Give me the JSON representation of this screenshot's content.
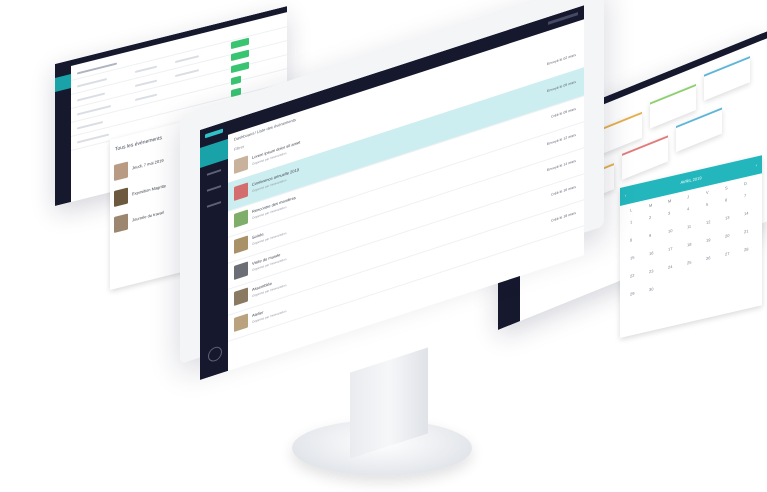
{
  "panels": {
    "list": {
      "section_title": "Tous les évènements",
      "items": [
        {
          "label": "Jeudi, 7 mai 2019"
        },
        {
          "label": "Exposition Magritte"
        },
        {
          "label": "Journée du travail"
        }
      ]
    },
    "monitor": {
      "breadcrumb": "Dashboard / Liste des évènements",
      "filter_label": "Filtrer",
      "rows": [
        {
          "title": "Lorem ipsum dolor sit amet",
          "meta": "Organisé par l'association",
          "status": "Envoyé le 02 mars"
        },
        {
          "title": "Conference annuelle 2019",
          "meta": "Organisé par l'association",
          "status": "Envoyé le 09 mars"
        },
        {
          "title": "Rencontre des membres",
          "meta": "Organisé par l'association",
          "status": "Créé le 09 mars"
        },
        {
          "title": "Soirée",
          "meta": "Organisé par l'association",
          "status": "Envoyé le 12 mars"
        },
        {
          "title": "Visite du musée",
          "meta": "Organisé par l'association",
          "status": "Envoyé le 14 mars"
        },
        {
          "title": "Assemblée",
          "meta": "Organisé par l'association",
          "status": "Créé le 16 mars"
        },
        {
          "title": "Atelier",
          "meta": "Organisé par l'association",
          "status": "Créé le 18 mars"
        }
      ]
    },
    "calendar": {
      "month": "AVRIL 2019",
      "weekdays": [
        "L",
        "M",
        "M",
        "J",
        "V",
        "S",
        "D"
      ],
      "days": [
        "1",
        "2",
        "3",
        "4",
        "5",
        "6",
        "7",
        "8",
        "9",
        "10",
        "11",
        "12",
        "13",
        "14",
        "15",
        "16",
        "17",
        "18",
        "19",
        "20",
        "21",
        "22",
        "23",
        "24",
        "25",
        "26",
        "27",
        "28",
        "29",
        "30"
      ]
    }
  }
}
